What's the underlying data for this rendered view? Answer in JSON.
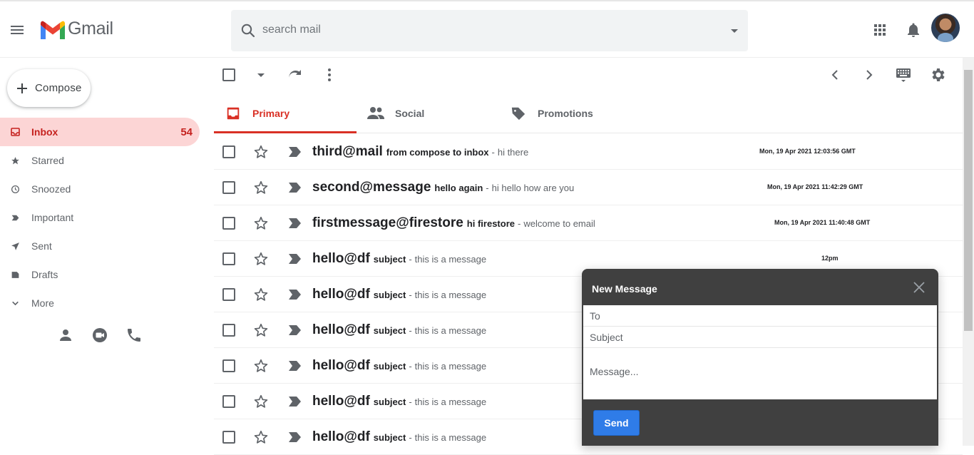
{
  "app": {
    "logo_text": "Gmail"
  },
  "search": {
    "placeholder": "search mail"
  },
  "compose": {
    "label": "Compose"
  },
  "sidebar": {
    "items": [
      {
        "label": "Inbox",
        "count": "54"
      },
      {
        "label": "Starred"
      },
      {
        "label": "Snoozed"
      },
      {
        "label": "Important"
      },
      {
        "label": "Sent"
      },
      {
        "label": "Drafts"
      },
      {
        "label": "More"
      }
    ]
  },
  "tabs": [
    {
      "label": "Primary"
    },
    {
      "label": "Social"
    },
    {
      "label": "Promotions"
    }
  ],
  "emails": [
    {
      "sender": "third@mail",
      "subject": "from compose to inbox",
      "snippet": "hi there",
      "date": "Mon, 19 Apr 2021 12:03:56 GMT"
    },
    {
      "sender": "second@message",
      "subject": "hello again",
      "snippet": "hi hello how are you",
      "date": "Mon, 19 Apr 2021 11:42:29 GMT"
    },
    {
      "sender": "firstmessage@firestore",
      "subject": "hi firestore",
      "snippet": "welcome to email",
      "date": "Mon, 19 Apr 2021 11:40:48 GMT"
    },
    {
      "sender": "hello@df",
      "subject": "subject",
      "snippet": "this is a message",
      "date": "12pm"
    },
    {
      "sender": "hello@df",
      "subject": "subject",
      "snippet": "this is a message",
      "date": ""
    },
    {
      "sender": "hello@df",
      "subject": "subject",
      "snippet": "this is a message",
      "date": ""
    },
    {
      "sender": "hello@df",
      "subject": "subject",
      "snippet": "this is a message",
      "date": ""
    },
    {
      "sender": "hello@df",
      "subject": "subject",
      "snippet": "this is a message",
      "date": ""
    },
    {
      "sender": "hello@df",
      "subject": "subject",
      "snippet": "this is a message",
      "date": ""
    }
  ],
  "new_message": {
    "title": "New Message",
    "to_placeholder": "To",
    "subject_placeholder": "Subject",
    "message_placeholder": "Message...",
    "send_label": "Send"
  },
  "colors": {
    "accent_red": "#d93025",
    "inbox_bg": "#fcd5d5",
    "send_blue": "#2f7ce8",
    "compose_header": "#404040"
  }
}
